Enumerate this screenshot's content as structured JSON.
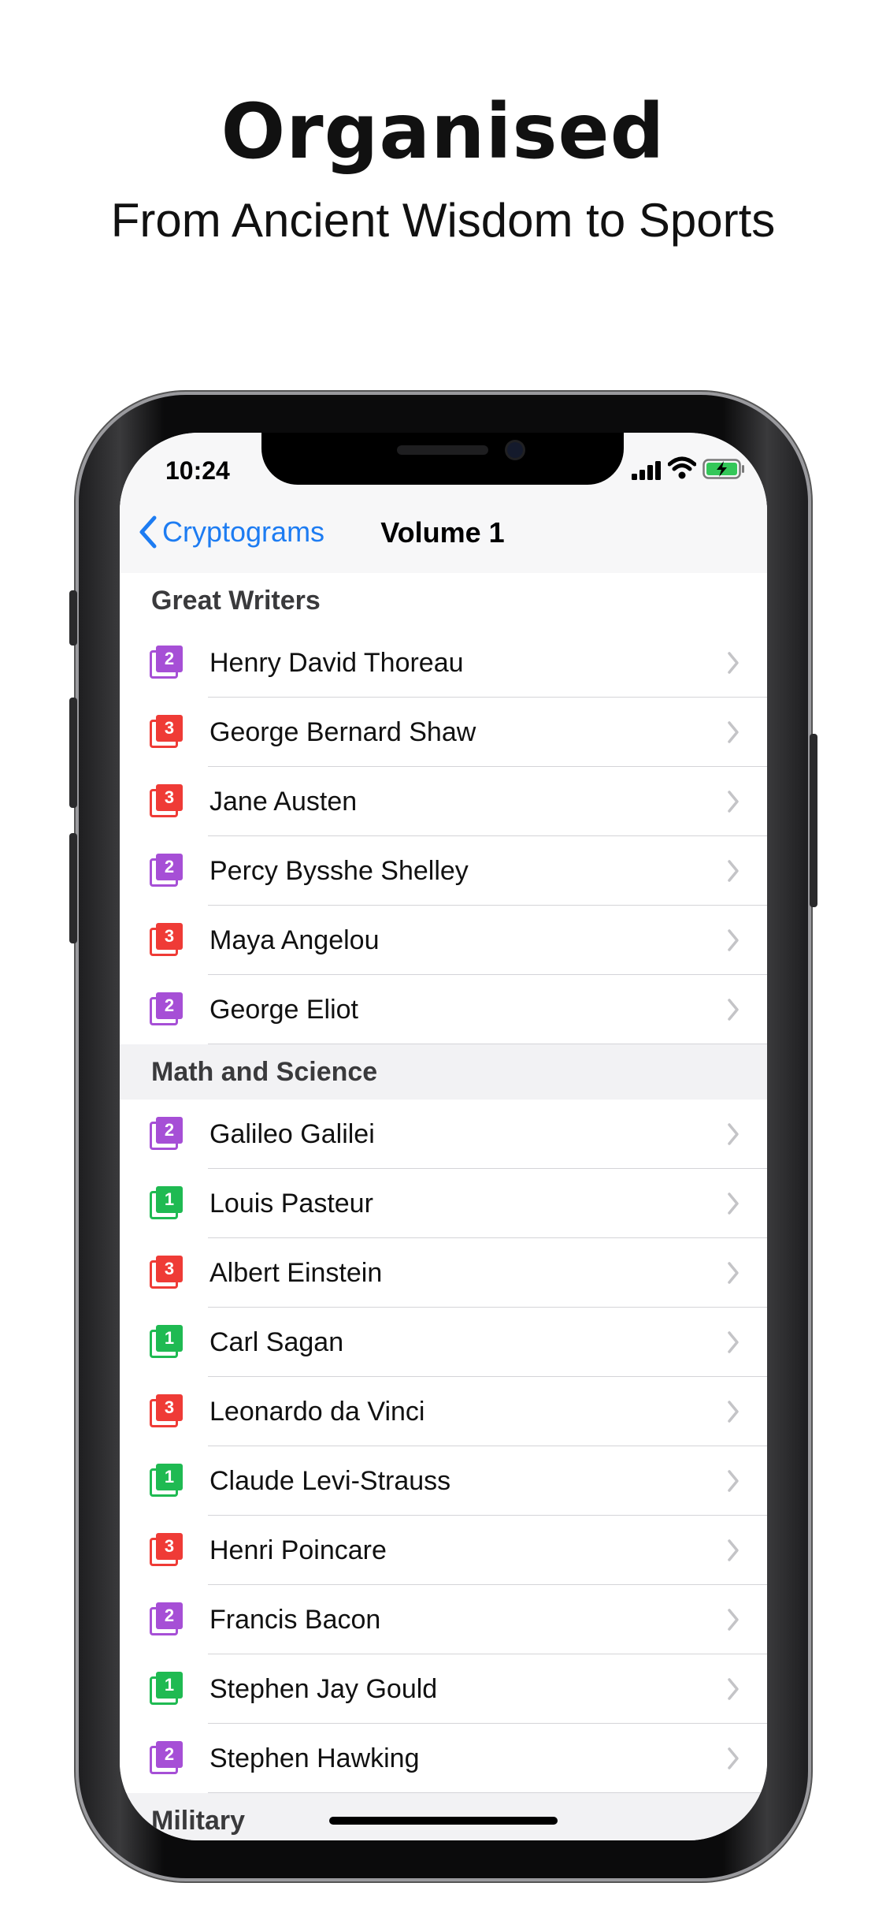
{
  "headline": "Organised",
  "subheadline": "From Ancient Wisdom to Sports",
  "status": {
    "time": "10:24"
  },
  "nav": {
    "back_label": "Cryptograms",
    "title": "Volume 1"
  },
  "colors": {
    "level1": "#1fba52",
    "level2": "#a64fd6",
    "level3": "#ef3b36",
    "accent": "#1d7cf2"
  },
  "sections": [
    {
      "title": "Great Writers",
      "items": [
        {
          "label": "Henry David Thoreau",
          "level": "2"
        },
        {
          "label": "George Bernard Shaw",
          "level": "3"
        },
        {
          "label": "Jane Austen",
          "level": "3"
        },
        {
          "label": "Percy Bysshe Shelley",
          "level": "2"
        },
        {
          "label": "Maya Angelou",
          "level": "3"
        },
        {
          "label": "George Eliot",
          "level": "2"
        }
      ]
    },
    {
      "title": "Math and Science",
      "items": [
        {
          "label": "Galileo Galilei",
          "level": "2"
        },
        {
          "label": "Louis Pasteur",
          "level": "1"
        },
        {
          "label": "Albert Einstein",
          "level": "3"
        },
        {
          "label": "Carl Sagan",
          "level": "1"
        },
        {
          "label": "Leonardo da Vinci",
          "level": "3"
        },
        {
          "label": "Claude Levi-Strauss",
          "level": "1"
        },
        {
          "label": "Henri Poincare",
          "level": "3"
        },
        {
          "label": "Francis Bacon",
          "level": "2"
        },
        {
          "label": "Stephen Jay Gould",
          "level": "1"
        },
        {
          "label": "Stephen Hawking",
          "level": "2"
        }
      ]
    },
    {
      "title": "Military",
      "items": []
    }
  ]
}
